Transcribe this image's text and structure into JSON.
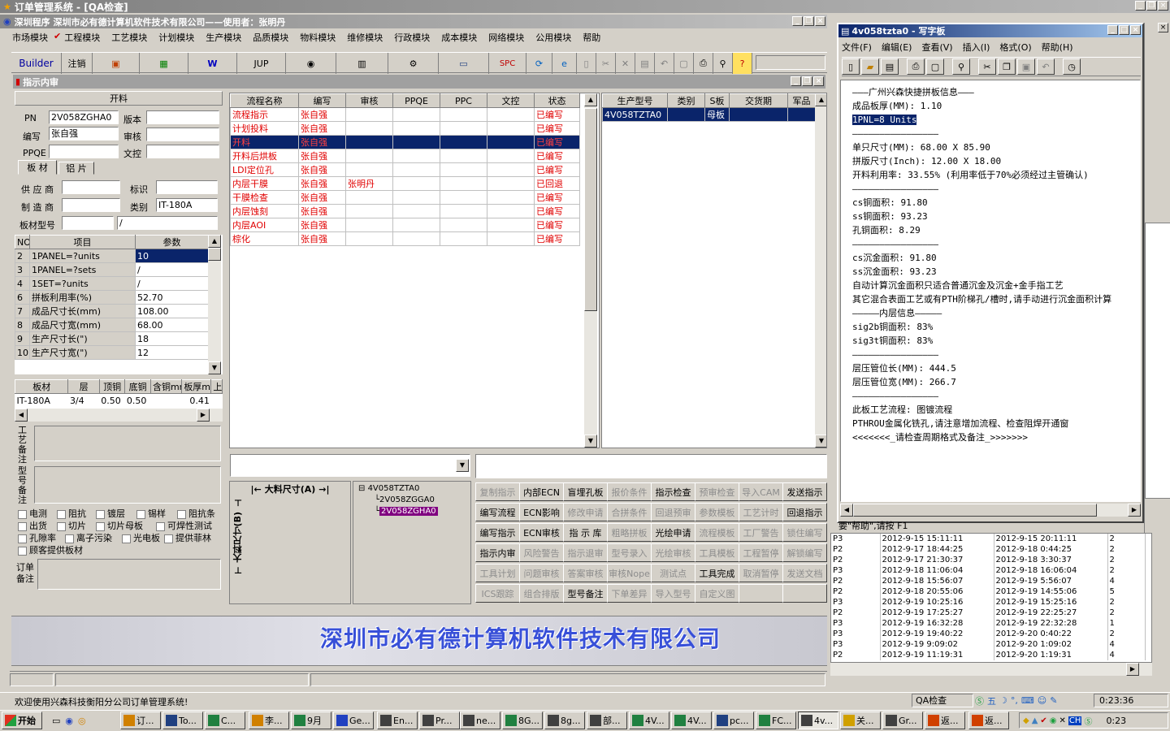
{
  "main_window": {
    "title": "订单管理系统 - [QA检查]",
    "company_bar": "深圳程序   深圳市必有德计算机软件技术有限公司——使用者：张明丹",
    "menu": [
      "市场模块",
      "工程模块",
      "工艺模块",
      "计划模块",
      "生产模块",
      "品质模块",
      "物料模块",
      "维修模块",
      "行政模块",
      "成本模块",
      "网络模块",
      "公用模块",
      "帮助"
    ],
    "toolbar": {
      "builder": "Builder",
      "cancel": "注销",
      "jup": "JUP",
      "spc": "SPC"
    },
    "child_title": "指示内审",
    "banner": "深圳市必有德计算机软件技术有限公司",
    "statusbar_left": "欢迎使用兴森科技衡阳分公司订单管理系统!",
    "statusbar_mid": "QA检查",
    "statusbar_time": "0:23:36"
  },
  "form": {
    "header": "开料",
    "pn_label": "PN",
    "pn_value": "2V058ZGHA0",
    "version_label": "版本",
    "writer_label": "编写",
    "writer_value": "张自强",
    "reviewer_label": "审核",
    "ppqe_label": "PPQE",
    "wenkong_label": "文控",
    "tab1": "板 材",
    "tab2": "铝 片",
    "supplier_label": "供 应 商",
    "mark_label": "标识",
    "maker_label": "制 造 商",
    "category_label": "类别",
    "category_value": "IT-180A",
    "board_model_label": "板材型号",
    "board_model_value": "/",
    "craft_note_label": "工艺备注",
    "model_note_label": "型号备注",
    "order_note_label": "订单备注"
  },
  "params_table": {
    "headers": [
      "NO",
      "项目",
      "参数"
    ],
    "rows": [
      {
        "no": "2",
        "item": "1PANEL=?units",
        "val": "10"
      },
      {
        "no": "3",
        "item": "1PANEL=?sets",
        "val": "/"
      },
      {
        "no": "4",
        "item": "1SET=?units",
        "val": "/"
      },
      {
        "no": "6",
        "item": "拼板利用率(%)",
        "val": "52.70"
      },
      {
        "no": "7",
        "item": "成品尺寸长(mm)",
        "val": "108.00"
      },
      {
        "no": "8",
        "item": "成品尺寸宽(mm)",
        "val": "68.00"
      },
      {
        "no": "9",
        "item": "生产尺寸长(\")",
        "val": "18"
      },
      {
        "no": "10",
        "item": "生产尺寸宽(\")",
        "val": "12"
      }
    ]
  },
  "layer_table": {
    "headers": [
      "板材",
      "层",
      "顶铜",
      "底铜",
      "含铜mm",
      "板厚mm",
      "上"
    ],
    "row": [
      "IT-180A",
      "3/4",
      "0.50",
      "0.50",
      "",
      "0.41",
      ""
    ]
  },
  "checkboxes": [
    [
      "电测",
      "阻抗",
      "镀层",
      "锡样",
      "阻抗条"
    ],
    [
      "出货",
      "切片",
      "切片母板",
      "可焊性测试"
    ],
    [
      "孔隙率",
      "离子污染",
      "光电板",
      "提供菲林"
    ],
    [
      "顾客提供板材"
    ]
  ],
  "flow_table": {
    "headers": [
      "流程名称",
      "编写",
      "审核",
      "PPQE",
      "PPC",
      "文控",
      "状态"
    ],
    "rows": [
      {
        "name": "流程指示",
        "writer": "张自强",
        "reviewer": "",
        "status": "已编写"
      },
      {
        "name": "计划投料",
        "writer": "张自强",
        "reviewer": "",
        "status": "已编写"
      },
      {
        "name": "开料",
        "writer": "张自强",
        "reviewer": "",
        "status": "已编写"
      },
      {
        "name": "开料后烘板",
        "writer": "张自强",
        "reviewer": "",
        "status": "已编写"
      },
      {
        "name": "LDI定位孔",
        "writer": "张自强",
        "reviewer": "",
        "status": "已编写"
      },
      {
        "name": "内层干膜",
        "writer": "张自强",
        "reviewer": "张明丹",
        "status": "已回退"
      },
      {
        "name": "干膜检查",
        "writer": "张自强",
        "reviewer": "",
        "status": "已编写"
      },
      {
        "name": "内层蚀刻",
        "writer": "张自强",
        "reviewer": "",
        "status": "已编写"
      },
      {
        "name": "内层AOI",
        "writer": "张自强",
        "reviewer": "",
        "status": "已编写"
      },
      {
        "name": "棕化",
        "writer": "张自强",
        "reviewer": "",
        "status": "已编写"
      }
    ]
  },
  "model_table": {
    "headers": [
      "生产型号",
      "类别",
      "S板",
      "交货期",
      "军品"
    ],
    "row": [
      "4V058TZTA0",
      "",
      "母板",
      "",
      ""
    ]
  },
  "size_panel": {
    "a_label": "大料尺寸(A)",
    "b_label": "大料尺寸(B)"
  },
  "tree": [
    "4V058TZTA0",
    "2V058ZGGA0",
    "2V058ZGHA0"
  ],
  "action_buttons": [
    [
      {
        "t": "复制指示",
        "d": true
      },
      {
        "t": "内部ECN",
        "d": false
      },
      {
        "t": "盲埋孔板",
        "d": false
      },
      {
        "t": "报价条件",
        "d": true
      },
      {
        "t": "指示检查",
        "d": false
      },
      {
        "t": "预审检查",
        "d": true
      },
      {
        "t": "导入CAM",
        "d": true
      },
      {
        "t": "发送指示",
        "d": false
      }
    ],
    [
      {
        "t": "编写流程",
        "d": false
      },
      {
        "t": "ECN影响",
        "d": false
      },
      {
        "t": "修改申请",
        "d": true
      },
      {
        "t": "合拼条件",
        "d": true
      },
      {
        "t": "回退预审",
        "d": true
      },
      {
        "t": "参数模板",
        "d": true
      },
      {
        "t": "工艺计时",
        "d": true
      },
      {
        "t": "回退指示",
        "d": false
      }
    ],
    [
      {
        "t": "编写指示",
        "d": false
      },
      {
        "t": "ECN审核",
        "d": false
      },
      {
        "t": "指 示 库",
        "d": false
      },
      {
        "t": "粗略拼板",
        "d": true
      },
      {
        "t": "光绘申请",
        "d": false
      },
      {
        "t": "流程模板",
        "d": true
      },
      {
        "t": "工厂警告",
        "d": true
      },
      {
        "t": "锁住编写",
        "d": true
      }
    ],
    [
      {
        "t": "指示内审",
        "d": false
      },
      {
        "t": "风险警告",
        "d": true
      },
      {
        "t": "指示退审",
        "d": true
      },
      {
        "t": "型号录入",
        "d": true
      },
      {
        "t": "光绘审核",
        "d": true
      },
      {
        "t": "工具模板",
        "d": true
      },
      {
        "t": "工程暂停",
        "d": true
      },
      {
        "t": "解锁编写",
        "d": true
      }
    ],
    [
      {
        "t": "工具计划",
        "d": true
      },
      {
        "t": "问题审核",
        "d": true
      },
      {
        "t": "答案审核",
        "d": true
      },
      {
        "t": "审核Nope",
        "d": true
      },
      {
        "t": "测试点",
        "d": true
      },
      {
        "t": "工具完成",
        "d": false
      },
      {
        "t": "取消暂停",
        "d": true
      },
      {
        "t": "发送文档",
        "d": true
      }
    ],
    [
      {
        "t": "ICS跟踪",
        "d": true
      },
      {
        "t": "组合排版",
        "d": true
      },
      {
        "t": "型号备注",
        "d": false
      },
      {
        "t": "下单差异",
        "d": true
      },
      {
        "t": "导入型号",
        "d": true
      },
      {
        "t": "自定义图",
        "d": true
      },
      {
        "t": "",
        "d": true
      },
      {
        "t": "",
        "d": true
      }
    ]
  ],
  "notepad": {
    "title": "4v058tzta0 - 写字板",
    "menu": [
      "文件(F)",
      "编辑(E)",
      "查看(V)",
      "插入(I)",
      "格式(O)",
      "帮助(H)"
    ],
    "lines": [
      "———广州兴森快捷拼板信息———",
      "成品板厚(MM): 1.10",
      "1PNL=8 Units",
      "————————————————",
      "单只尺寸(MM): 68.00 X 85.90",
      "拼版尺寸(Inch): 12.00 X 18.00",
      "开料利用率: 33.55% (利用率低于70%必须经过主管确认)",
      "————————————————",
      "cs铜面积: 91.80",
      "ss铜面积: 93.23",
      "孔铜面积: 8.29",
      "————————————————",
      "cs沉金面积: 91.80",
      "ss沉金面积: 93.23",
      "自动计算沉金面积只适合普通沉金及沉金+金手指工艺",
      "其它混合表面工艺或有PTH阶梯孔/槽时,请手动进行沉金面积计算",
      "—————内层信息—————",
      "sig2b铜面积: 83%",
      "sig3t铜面积: 83%",
      "————————————————",
      "层压管位长(MM): 444.5",
      "层压管位宽(MM): 266.7",
      "————————————————",
      "此板工艺流程: 图镀流程",
      "PTHROU金属化铣孔,请注意增加流程、检查阻焊开通窗",
      "<<<<<<<_请检查周期格式及备注_>>>>>>>"
    ],
    "status": "要\"帮助\",请按 F1"
  },
  "log_table": {
    "rows": [
      [
        "P3",
        "2012-9-15 15:11:11",
        "2012-9-15 20:11:11",
        "2"
      ],
      [
        "P2",
        "2012-9-17 18:44:25",
        "2012-9-18 0:44:25",
        "2"
      ],
      [
        "P2",
        "2012-9-17 21:30:37",
        "2012-9-18 3:30:37",
        "2"
      ],
      [
        "P3",
        "2012-9-18 11:06:04",
        "2012-9-18 16:06:04",
        "2"
      ],
      [
        "P2",
        "2012-9-18 15:56:07",
        "2012-9-19 5:56:07",
        "4"
      ],
      [
        "P2",
        "2012-9-18 20:55:06",
        "2012-9-19 14:55:06",
        "5"
      ],
      [
        "P3",
        "2012-9-19 10:25:16",
        "2012-9-19 15:25:16",
        "2"
      ],
      [
        "P2",
        "2012-9-19 17:25:27",
        "2012-9-19 22:25:27",
        "2"
      ],
      [
        "P3",
        "2012-9-19 16:32:28",
        "2012-9-19 22:32:28",
        "1"
      ],
      [
        "P3",
        "2012-9-19 19:40:22",
        "2012-9-20 0:40:22",
        "2"
      ],
      [
        "P3",
        "2012-9-19 9:09:02",
        "2012-9-20 1:09:02",
        "4"
      ],
      [
        "P2",
        "2012-9-19 11:19:31",
        "2012-9-20 1:19:31",
        "4"
      ]
    ]
  },
  "taskbar": {
    "start": "开始",
    "items": [
      "订...",
      "To...",
      "C...",
      "李...",
      "9月",
      "Ge...",
      "En...",
      "Pr...",
      "ne...",
      "8G...",
      "8g...",
      "部...",
      "4V...",
      "4V...",
      "pc...",
      "FC...",
      "4v...",
      "关...",
      "Gr...",
      "返...",
      "返..."
    ],
    "clock": "0:23"
  }
}
